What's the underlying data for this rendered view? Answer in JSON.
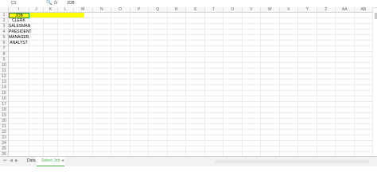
{
  "formula_bar": {
    "name_box": "C1",
    "zoom_icon": "zoom-icon",
    "fx_label": "fx",
    "value": "JOB"
  },
  "columns": [
    "I",
    "J",
    "K",
    "L",
    "M",
    "N",
    "O",
    "P",
    "Q",
    "R",
    "S",
    "T",
    "U",
    "V",
    "W",
    "X",
    "Y",
    "Z",
    "AA",
    "AB"
  ],
  "rows": [
    "1",
    "2",
    "3",
    "4",
    "5",
    "6",
    "7",
    "8",
    "9",
    "10",
    "11",
    "12",
    "13",
    "14",
    "15",
    "16",
    "17",
    "18",
    "19",
    "20",
    "21",
    "22",
    "23",
    "24",
    "25",
    "26"
  ],
  "cells": [
    {
      "row": 1,
      "text": "JOB",
      "selected": true
    },
    {
      "row": 2,
      "text": "CLERK"
    },
    {
      "row": 3,
      "text": "SALESMAN"
    },
    {
      "row": 4,
      "text": "PRESIDENT"
    },
    {
      "row": 5,
      "text": "MANAGER"
    },
    {
      "row": 6,
      "text": "ANALYST"
    }
  ],
  "colors": {
    "highlight": "#ffff00",
    "accent": "#4caf50",
    "selection_border": "#1e8e3e"
  },
  "sheet_tabs": [
    {
      "label": "Data",
      "active": false
    },
    {
      "label": "Select Job",
      "active": true
    }
  ],
  "add_sheet_label": "+",
  "nav_icons": [
    "first-sheet-icon",
    "prev-sheet-icon",
    "next-sheet-icon",
    "last-sheet-icon"
  ]
}
